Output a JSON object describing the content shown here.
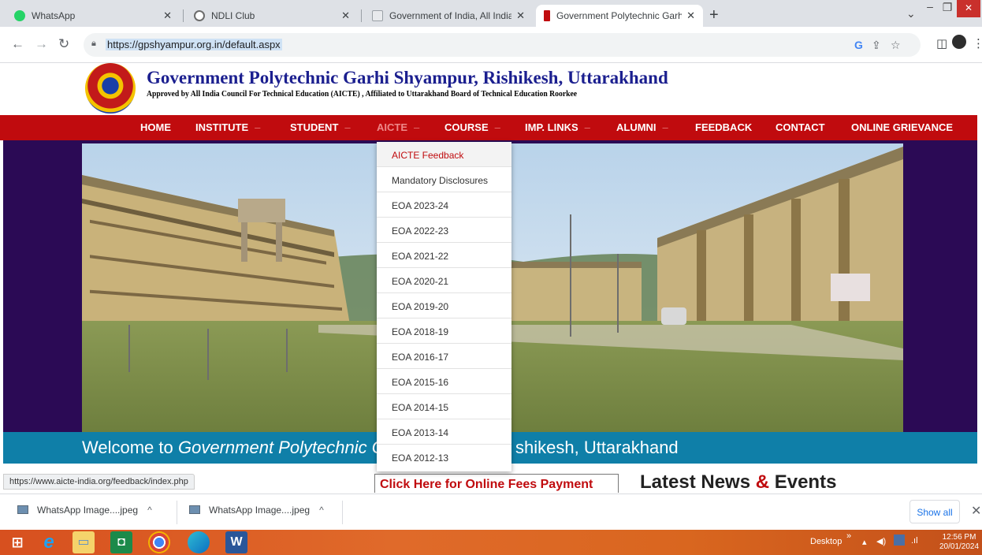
{
  "browser": {
    "tabs": [
      {
        "title": "WhatsApp",
        "favicon_color": "#25d366",
        "active": false
      },
      {
        "title": "NDLI Club",
        "favicon_color": "#6c6c6c",
        "active": false
      },
      {
        "title": "Government of India, All India Co",
        "favicon_color": "#9aa0a6",
        "active": false
      },
      {
        "title": "Government Polytechnic Garhi Sh",
        "favicon_color": "#c00b0e",
        "active": true
      }
    ],
    "new_tab": "+",
    "url": "https://gpshyampur.org.in/default.aspx"
  },
  "site": {
    "title": "Government Polytechnic Garhi Shyampur, Rishikesh, Uttarakhand",
    "subtitle": "Approved by All India Council For Technical Education (AICTE) , Affiliated to Uttarakhand Board of Technical Education Roorkee"
  },
  "nav": {
    "items": [
      {
        "label": "HOME",
        "dropdown": false
      },
      {
        "label": "INSTITUTE",
        "dropdown": true
      },
      {
        "label": "STUDENT",
        "dropdown": true
      },
      {
        "label": "AICTE",
        "dropdown": true
      },
      {
        "label": "COURSE",
        "dropdown": true
      },
      {
        "label": "IMP. LINKS",
        "dropdown": true
      },
      {
        "label": "ALUMNI",
        "dropdown": true
      },
      {
        "label": "FEEDBACK",
        "dropdown": false
      },
      {
        "label": "CONTACT",
        "dropdown": false
      },
      {
        "label": "ONLINE GRIEVANCE",
        "dropdown": false
      }
    ],
    "arrow": "–"
  },
  "aicte_menu": [
    "AICTE Feedback",
    "Mandatory Disclosures",
    "EOA 2023-24",
    "EOA 2022-23",
    "EOA 2021-22",
    "EOA 2020-21",
    "EOA 2019-20",
    "EOA 2018-19",
    "EOA 2016-17",
    "EOA 2015-16",
    "EOA 2014-15",
    "EOA 2013-14",
    "EOA 2012-13"
  ],
  "welcome": {
    "prefix": "Welcome to ",
    "italic": "Government Polytechnic G",
    "suffix": "shikesh, Uttarakhand"
  },
  "status_url": "https://www.aicte-india.org/feedback/index.php",
  "fees_link": "Click Here for Online Fees Payment",
  "news": {
    "part1": "Latest News ",
    "amp": "&",
    "part2": " Events"
  },
  "downloads": {
    "items": [
      "WhatsApp Image....jpeg",
      "WhatsApp Image....jpeg"
    ],
    "show_all": "Show all"
  },
  "taskbar": {
    "desktop_label": "Desktop",
    "time": "12:56 PM",
    "date": "20/01/2024"
  },
  "colors": {
    "nav_red": "#c00b0e",
    "title_blue": "#1b1f8f",
    "welcome_teal": "#0f7fa8",
    "banner_purple": "#2b0a55"
  }
}
